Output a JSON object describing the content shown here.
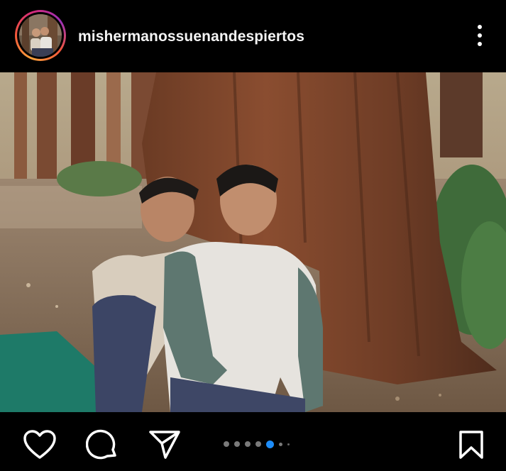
{
  "post": {
    "username": "mishermanossuenandespiertos"
  },
  "carousel": {
    "total": 6,
    "active_index": 4
  },
  "colors": {
    "background": "#000000",
    "active_dot": "#1d8cf8",
    "inactive_dot": "#7a7a7a"
  },
  "icons": {
    "more": "more-vertical-icon",
    "like": "heart-icon",
    "comment": "comment-bubble-icon",
    "share": "paper-plane-icon",
    "save": "bookmark-icon"
  }
}
